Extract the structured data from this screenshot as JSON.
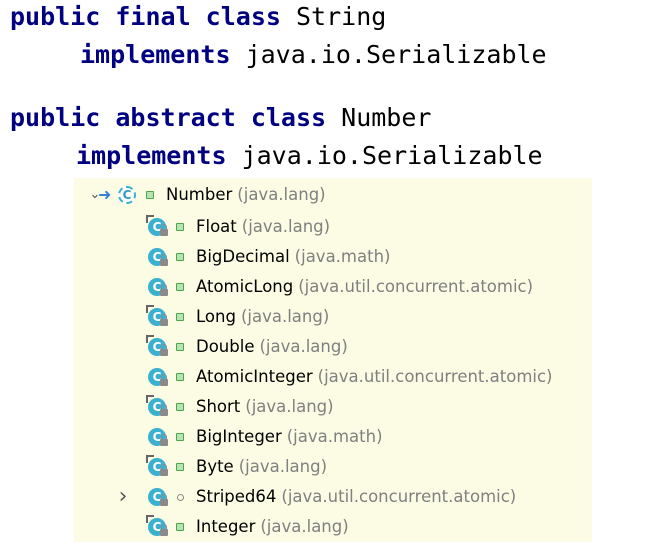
{
  "code": {
    "block1": {
      "line1_kw": "public final class",
      "line1_name": "String",
      "line2_kw": "implements",
      "line2_iface": "java.io.Serializable"
    },
    "block2": {
      "line1_kw": "public abstract class",
      "line1_name": "Number",
      "line2_kw": "implements",
      "line2_iface": "java.io.Serializable"
    }
  },
  "hierarchy": {
    "root": {
      "name": "Number",
      "package": "(java.lang)",
      "icon": "abstract-class-icon",
      "expander": "chevron-down-icon"
    },
    "children": [
      {
        "name": "Float",
        "package": "(java.lang)",
        "final": true
      },
      {
        "name": "BigDecimal",
        "package": "(java.math)",
        "final": false
      },
      {
        "name": "AtomicLong",
        "package": "(java.util.concurrent.atomic)",
        "final": false
      },
      {
        "name": "Long",
        "package": "(java.lang)",
        "final": true
      },
      {
        "name": "Double",
        "package": "(java.lang)",
        "final": true
      },
      {
        "name": "AtomicInteger",
        "package": "(java.util.concurrent.atomic)",
        "final": false
      },
      {
        "name": "Short",
        "package": "(java.lang)",
        "final": true
      },
      {
        "name": "BigInteger",
        "package": "(java.math)",
        "final": false
      },
      {
        "name": "Byte",
        "package": "(java.lang)",
        "final": true
      },
      {
        "name": "Striped64",
        "package": "(java.util.concurrent.atomic)",
        "final": false,
        "expandable": true,
        "visibility": "package-private"
      },
      {
        "name": "Integer",
        "package": "(java.lang)",
        "final": true
      }
    ]
  },
  "colors": {
    "keyword": "#000080",
    "panel_background": "#fcfce4",
    "class_icon": "#3bb1cf",
    "package_text": "#808080"
  }
}
